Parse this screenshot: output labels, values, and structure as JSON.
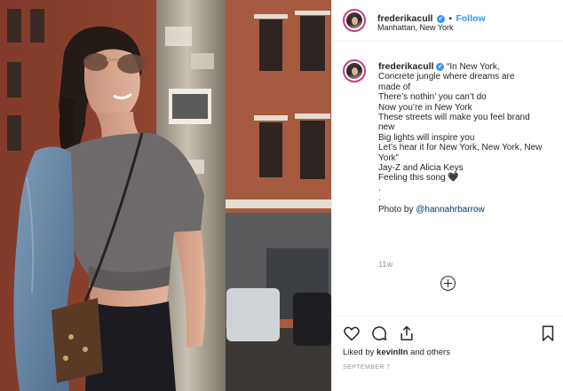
{
  "post": {
    "username": "frederikacull",
    "verified_mark": "✔",
    "separator": "•",
    "follow_label": "Follow",
    "location": "Manhattan, New York",
    "caption_lines": [
      "“In New York,",
      "Concrete jungle where dreams are made of",
      "There’s nothin’ you can’t do",
      "Now you’re in New York",
      "These streets will make you feel brand new",
      "Big lights will inspire you",
      "Let’s hear it for New York, New York, New York”",
      "Jay-Z and Alicia Keys",
      "Feeling this song"
    ],
    "heart_emoji": "🖤",
    "dots": [
      ".",
      "."
    ],
    "photo_by_prefix": "Photo by ",
    "photo_by_handle": "@hannahrbarrow",
    "time_ago": "11w",
    "likes_prefix": "Liked by ",
    "likes_user": "kevinlln",
    "likes_suffix": " and others",
    "date": "SEPTEMBER 7"
  },
  "icons": {
    "heart": "heart-icon",
    "comment": "comment-icon",
    "share": "share-icon",
    "save": "bookmark-icon",
    "load_more": "plus-circle-icon"
  },
  "colors": {
    "link_blue": "#3897f0",
    "mention": "#00376b",
    "muted": "#999999",
    "text": "#262626"
  }
}
